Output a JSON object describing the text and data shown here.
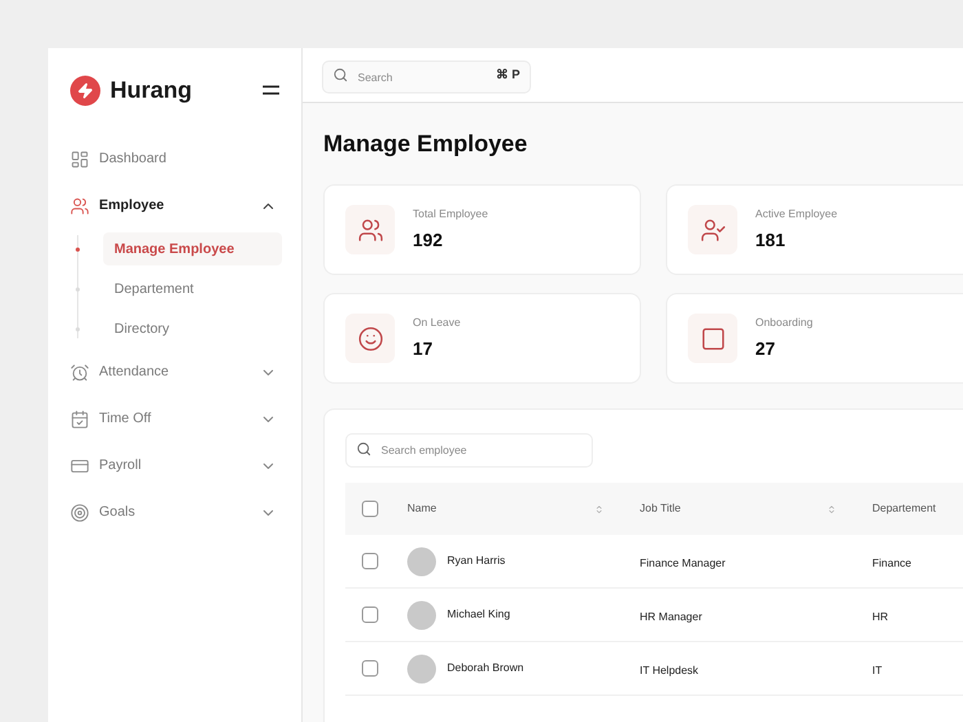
{
  "sidebar": {
    "brand": "Hurang",
    "items": [
      {
        "label": "Dashboard",
        "selected": false
      },
      {
        "label": "Employee",
        "selected": true,
        "expanded": true,
        "children": [
          {
            "label": "Manage Employee",
            "selected": true
          },
          {
            "label": "Departement",
            "selected": false
          },
          {
            "label": "Directory",
            "selected": false
          }
        ]
      },
      {
        "label": "Attendance",
        "selected": false,
        "expanded": false
      },
      {
        "label": "Time Off",
        "selected": false,
        "expanded": false
      },
      {
        "label": "Payroll",
        "selected": false,
        "expanded": false
      },
      {
        "label": "Goals",
        "selected": false,
        "expanded": false
      }
    ]
  },
  "topbar": {
    "search": {
      "placeholder": "Search",
      "shortcut": "⌘ P"
    }
  },
  "page_title": "Manage Employee",
  "stats": [
    {
      "label": "Total Employee",
      "value": "192"
    },
    {
      "label": "Active Employee",
      "value": "181"
    },
    {
      "label": "On Leave",
      "value": "17"
    },
    {
      "label": "Onboarding",
      "value": "27"
    }
  ],
  "table": {
    "search": {
      "placeholder": "Search employee"
    },
    "header_checked": false,
    "columns": [
      {
        "label": "Name",
        "sortable": true
      },
      {
        "label": "Job Title",
        "sortable": true
      },
      {
        "label": "Departement"
      }
    ],
    "rows": [
      {
        "checked": false,
        "name": "Ryan Harris",
        "job_title": "Finance Manager",
        "department": "Finance"
      },
      {
        "checked": false,
        "name": "Michael King",
        "job_title": "HR Manager",
        "department": "HR"
      },
      {
        "checked": false,
        "name": "Deborah Brown",
        "job_title": "IT Helpdesk",
        "department": "IT"
      }
    ]
  }
}
